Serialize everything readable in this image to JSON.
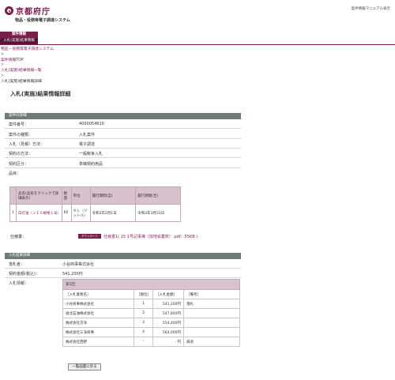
{
  "header": {
    "logo_text": "京都府庁",
    "system_name": "物品・役務等電子調達システム",
    "manual_link": "案件情報マニュアル表示"
  },
  "nav": {
    "tab_main": "案件情報",
    "tab_sub": "入札(実施)結果情報"
  },
  "breadcrumb": {
    "items": [
      "物品・役務等電子調達システム",
      "案件情報TOP",
      "入札(実施)結果情報一覧"
    ],
    "separator": ">",
    "current": "入札(実施)結果情報詳細"
  },
  "page": {
    "title": "入札(実施)結果情報詳細"
  },
  "case_detail": {
    "section_title": "案件の詳細",
    "fields": [
      {
        "label": "案件番号：",
        "value": "4000054610"
      },
      {
        "label": "案件の種類：",
        "value": "入札案件"
      },
      {
        "label": "入札（見積）方法：",
        "value": "電子調達"
      },
      {
        "label": "契約の方法：",
        "value": "一般競争入札"
      },
      {
        "label": "契約区分：",
        "value": "単価契約用品"
      },
      {
        "label": "品目：",
        "value": ""
      }
    ],
    "items_table": {
      "headers": [
        "",
        "品名(品名をクリックで詳細表示)",
        "数量",
        "単位",
        "履行期間(自)",
        "履行期間(至)"
      ],
      "rows": [
        [
          "1",
          "白灯油（ＪＩＳ規格１号）",
          "60",
          "ＫＬ（リットル）",
          "令和3年2月1日",
          "令和3年3月31日"
        ]
      ]
    },
    "spec_label": "仕様書：",
    "download_badge": "ダウンロード",
    "spec_link": "仕様書1( 15 1号記事簿（加地会業校）.pdf：55KB )"
  },
  "bid_result": {
    "section_title": "入札結果詳細",
    "fields": [
      {
        "label": "落札者：",
        "value": "小谷商事株式会社"
      },
      {
        "label": "契約金額(税込)：",
        "value": "541,200円"
      },
      {
        "label": "入札情報：",
        "value": ""
      }
    ],
    "round_label": "第1回",
    "table_headers": [
      "［入札業者名］",
      "［順位］",
      "［入札金額］",
      "［備考］"
    ],
    "rows": [
      [
        "小谷商事株式会社",
        "1",
        "541,200円",
        "落札"
      ],
      [
        "滋北石油株式会社",
        "2",
        "547,800円",
        ""
      ],
      [
        "株式会社京洋",
        "3",
        "554,400円",
        ""
      ],
      [
        "株式会社三洋商事",
        "4",
        "564,000円",
        ""
      ],
      [
        "株式会社西野",
        "-",
        "- 円",
        "辞退"
      ]
    ]
  },
  "footer": {
    "back_button": "一覧画面に戻る"
  },
  "colors": {
    "brand": "#7a1f4a",
    "section_bar": "#6d7a78",
    "table_header": "#d8c2cc",
    "link": "#8a1f5a"
  }
}
